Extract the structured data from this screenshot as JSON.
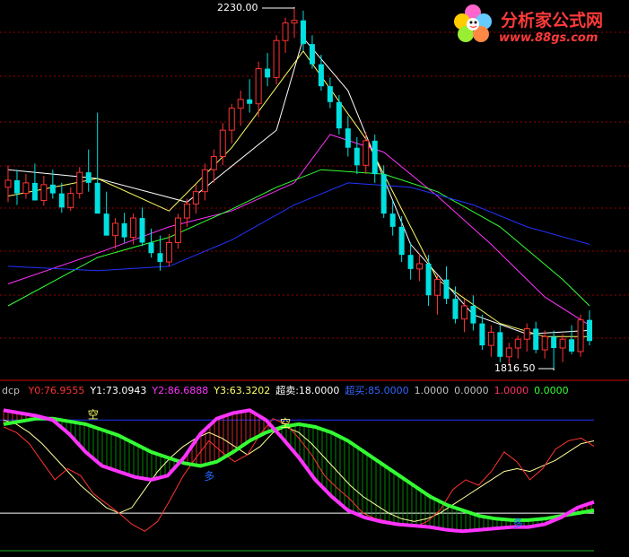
{
  "chart_data": [
    {
      "type": "candlestick",
      "high_label": "2230.00",
      "low_label": "1816.50",
      "high": 2230.0,
      "low": 1816.5,
      "colors": {
        "up": "#ff3333",
        "down": "#00e0e0",
        "ma1": "#ffffff",
        "ma2": "#ffff66",
        "ma3": "#ff33ff",
        "ma4": "#33ff33",
        "ma5": "#2233ff",
        "grid": "#990000"
      },
      "candles": [
        [
          2025,
          2050,
          2008,
          2033
        ],
        [
          2033,
          2045,
          2005,
          2018
        ],
        [
          2018,
          2040,
          2012,
          2030
        ],
        [
          2030,
          2052,
          2020,
          2010
        ],
        [
          2010,
          2038,
          2004,
          2028
        ],
        [
          2028,
          2045,
          2012,
          2018
        ],
        [
          2018,
          2030,
          1996,
          2002
        ],
        [
          2002,
          2025,
          1998,
          2018
        ],
        [
          2018,
          2048,
          2012,
          2042
        ],
        [
          2042,
          2068,
          2020,
          2030
        ],
        [
          2030,
          2110,
          2010,
          1995
        ],
        [
          1995,
          2020,
          1970,
          1970
        ],
        [
          1970,
          1990,
          1955,
          1984
        ],
        [
          1984,
          1996,
          1962,
          1968
        ],
        [
          1968,
          1995,
          1960,
          1990
        ],
        [
          1990,
          2002,
          1958,
          1962
        ],
        [
          1962,
          1978,
          1945,
          1950
        ],
        [
          1950,
          1970,
          1930,
          1940
        ],
        [
          1940,
          1972,
          1935,
          1962
        ],
        [
          1962,
          1995,
          1955,
          1990
        ],
        [
          1990,
          2012,
          1980,
          2006
        ],
        [
          2006,
          2028,
          1995,
          2020
        ],
        [
          2020,
          2052,
          2010,
          2045
        ],
        [
          2045,
          2068,
          2030,
          2060
        ],
        [
          2060,
          2098,
          2050,
          2090
        ],
        [
          2090,
          2120,
          2075,
          2115
        ],
        [
          2115,
          2135,
          2095,
          2125
        ],
        [
          2125,
          2148,
          2110,
          2120
        ],
        [
          2120,
          2168,
          2105,
          2160
        ],
        [
          2160,
          2178,
          2140,
          2150
        ],
        [
          2150,
          2198,
          2142,
          2192
        ],
        [
          2192,
          2218,
          2178,
          2212
        ],
        [
          2212,
          2230,
          2195,
          2215
        ],
        [
          2215,
          2226,
          2180,
          2188
        ],
        [
          2188,
          2198,
          2160,
          2165
        ],
        [
          2165,
          2176,
          2135,
          2140
        ],
        [
          2140,
          2150,
          2115,
          2122
        ],
        [
          2122,
          2130,
          2085,
          2092
        ],
        [
          2092,
          2106,
          2060,
          2070
        ],
        [
          2070,
          2082,
          2040,
          2050
        ],
        [
          2050,
          2088,
          2040,
          2078
        ],
        [
          2078,
          2085,
          2030,
          2040
        ],
        [
          2040,
          2050,
          1990,
          1995
        ],
        [
          1995,
          2010,
          1970,
          1980
        ],
        [
          1980,
          1992,
          1940,
          1948
        ],
        [
          1948,
          1962,
          1920,
          1932
        ],
        [
          1932,
          1950,
          1918,
          1938
        ],
        [
          1938,
          1948,
          1890,
          1902
        ],
        [
          1902,
          1925,
          1880,
          1920
        ],
        [
          1920,
          1935,
          1892,
          1898
        ],
        [
          1898,
          1912,
          1870,
          1875
        ],
        [
          1875,
          1898,
          1860,
          1890
        ],
        [
          1890,
          1902,
          1862,
          1870
        ],
        [
          1870,
          1880,
          1840,
          1845
        ],
        [
          1845,
          1868,
          1832,
          1860
        ],
        [
          1860,
          1868,
          1826,
          1832
        ],
        [
          1832,
          1848,
          1822,
          1842
        ],
        [
          1842,
          1856,
          1830,
          1852
        ],
        [
          1852,
          1870,
          1838,
          1864
        ],
        [
          1864,
          1872,
          1836,
          1840
        ],
        [
          1840,
          1862,
          1830,
          1855
        ],
        [
          1855,
          1862,
          1816.5,
          1842
        ],
        [
          1842,
          1858,
          1826,
          1852
        ],
        [
          1852,
          1868,
          1835,
          1838
        ],
        [
          1838,
          1880,
          1832,
          1874
        ],
        [
          1874,
          1885,
          1845,
          1850
        ]
      ],
      "lines": {
        "ma5": [
          [
            0,
            2045
          ],
          [
            10,
            2035
          ],
          [
            20,
            2008
          ],
          [
            30,
            2090
          ],
          [
            33,
            2195
          ],
          [
            38,
            2135
          ],
          [
            45,
            1960
          ],
          [
            52,
            1880
          ],
          [
            58,
            1858
          ],
          [
            65,
            1862
          ]
        ],
        "ma10": [
          [
            0,
            2015
          ],
          [
            10,
            2035
          ],
          [
            18,
            1998
          ],
          [
            25,
            2070
          ],
          [
            33,
            2180
          ],
          [
            40,
            2080
          ],
          [
            48,
            1920
          ],
          [
            55,
            1870
          ],
          [
            60,
            1855
          ],
          [
            65,
            1855
          ]
        ],
        "ma30": [
          [
            0,
            1915
          ],
          [
            10,
            1950
          ],
          [
            18,
            1980
          ],
          [
            25,
            1998
          ],
          [
            32,
            2030
          ],
          [
            36,
            2085
          ],
          [
            42,
            2065
          ],
          [
            48,
            2015
          ],
          [
            54,
            1960
          ],
          [
            60,
            1900
          ],
          [
            65,
            1868
          ]
        ],
        "ma60": [
          [
            0,
            1890
          ],
          [
            10,
            1945
          ],
          [
            18,
            1968
          ],
          [
            25,
            2000
          ],
          [
            30,
            2025
          ],
          [
            35,
            2045
          ],
          [
            42,
            2040
          ],
          [
            48,
            2020
          ],
          [
            55,
            1980
          ],
          [
            62,
            1920
          ],
          [
            65,
            1890
          ]
        ],
        "ma120": [
          [
            0,
            1935
          ],
          [
            10,
            1930
          ],
          [
            18,
            1935
          ],
          [
            25,
            1965
          ],
          [
            32,
            2005
          ],
          [
            38,
            2030
          ],
          [
            45,
            2025
          ],
          [
            52,
            2005
          ],
          [
            58,
            1980
          ],
          [
            65,
            1960
          ]
        ]
      }
    },
    {
      "type": "line",
      "indicator_name": "dcp",
      "legend": [
        {
          "text": "Y0:76.9555",
          "color": "#ff3333"
        },
        {
          "text": "Y1:73.0943",
          "color": "#ffffff"
        },
        {
          "text": "Y2:86.6888",
          "color": "#ff33ff"
        },
        {
          "text": "Y3:63.3202",
          "color": "#ffff66"
        },
        {
          "text": "超卖:18.0000",
          "color": "#ffffff"
        },
        {
          "text": "超买:85.0000",
          "color": "#3366ff"
        },
        {
          "text": "1.0000",
          "color": "#c0c0c0"
        },
        {
          "text": "0.0000",
          "color": "#c0c0c0"
        },
        {
          "text": "1.0000",
          "color": "#ff3366"
        },
        {
          "text": "0.0000",
          "color": "#33ff33"
        }
      ],
      "ylim": [
        0,
        100
      ],
      "overbought": 85.0,
      "oversold": 18.0,
      "markers": [
        {
          "x": 9.5,
          "y": 86,
          "text": "空",
          "color": "#ffff66"
        },
        {
          "x": 31,
          "y": 80,
          "text": "空",
          "color": "#ffff66"
        },
        {
          "x": 22.5,
          "y": 42,
          "text": "多",
          "color": "#2266ff"
        },
        {
          "x": 57,
          "y": 8,
          "text": "多",
          "color": "#2266ff"
        }
      ],
      "Y0": [
        80,
        76,
        68,
        55,
        42,
        50,
        45,
        32,
        25,
        18,
        10,
        5,
        12,
        28,
        45,
        58,
        70,
        62,
        55,
        60,
        75,
        86,
        82,
        72,
        60,
        45,
        36,
        28,
        18,
        14,
        12,
        10,
        8,
        12,
        20,
        35,
        42,
        38,
        48,
        62,
        55,
        42,
        50,
        64,
        70,
        72,
        66
      ],
      "Y1": [
        85,
        82,
        76,
        68,
        58,
        48,
        38,
        30,
        22,
        18,
        22,
        35,
        48,
        58,
        66,
        72,
        76,
        72,
        66,
        60,
        66,
        76,
        80,
        76,
        68,
        58,
        48,
        38,
        30,
        24,
        18,
        14,
        12,
        14,
        18,
        24,
        30,
        36,
        42,
        48,
        50,
        48,
        52,
        56,
        62,
        68,
        70
      ],
      "Y2": [
        92,
        90,
        88,
        85,
        75,
        62,
        52,
        48,
        44,
        42,
        45,
        58,
        75,
        86,
        90,
        92,
        85,
        72,
        58,
        42,
        30,
        20,
        15,
        12,
        10,
        9,
        8,
        6,
        5,
        6,
        7,
        8,
        8,
        10,
        15,
        22,
        26
      ],
      "Y3": [
        82,
        84,
        86,
        86,
        84,
        82,
        78,
        74,
        68,
        62,
        58,
        54,
        52,
        55,
        62,
        70,
        76,
        80,
        82,
        80,
        76,
        70,
        62,
        54,
        46,
        38,
        30,
        24,
        20,
        16,
        14,
        13,
        13,
        14,
        16,
        18,
        20
      ]
    }
  ],
  "logo": {
    "title": "分析家公式网",
    "url": "www.88gs.com"
  }
}
